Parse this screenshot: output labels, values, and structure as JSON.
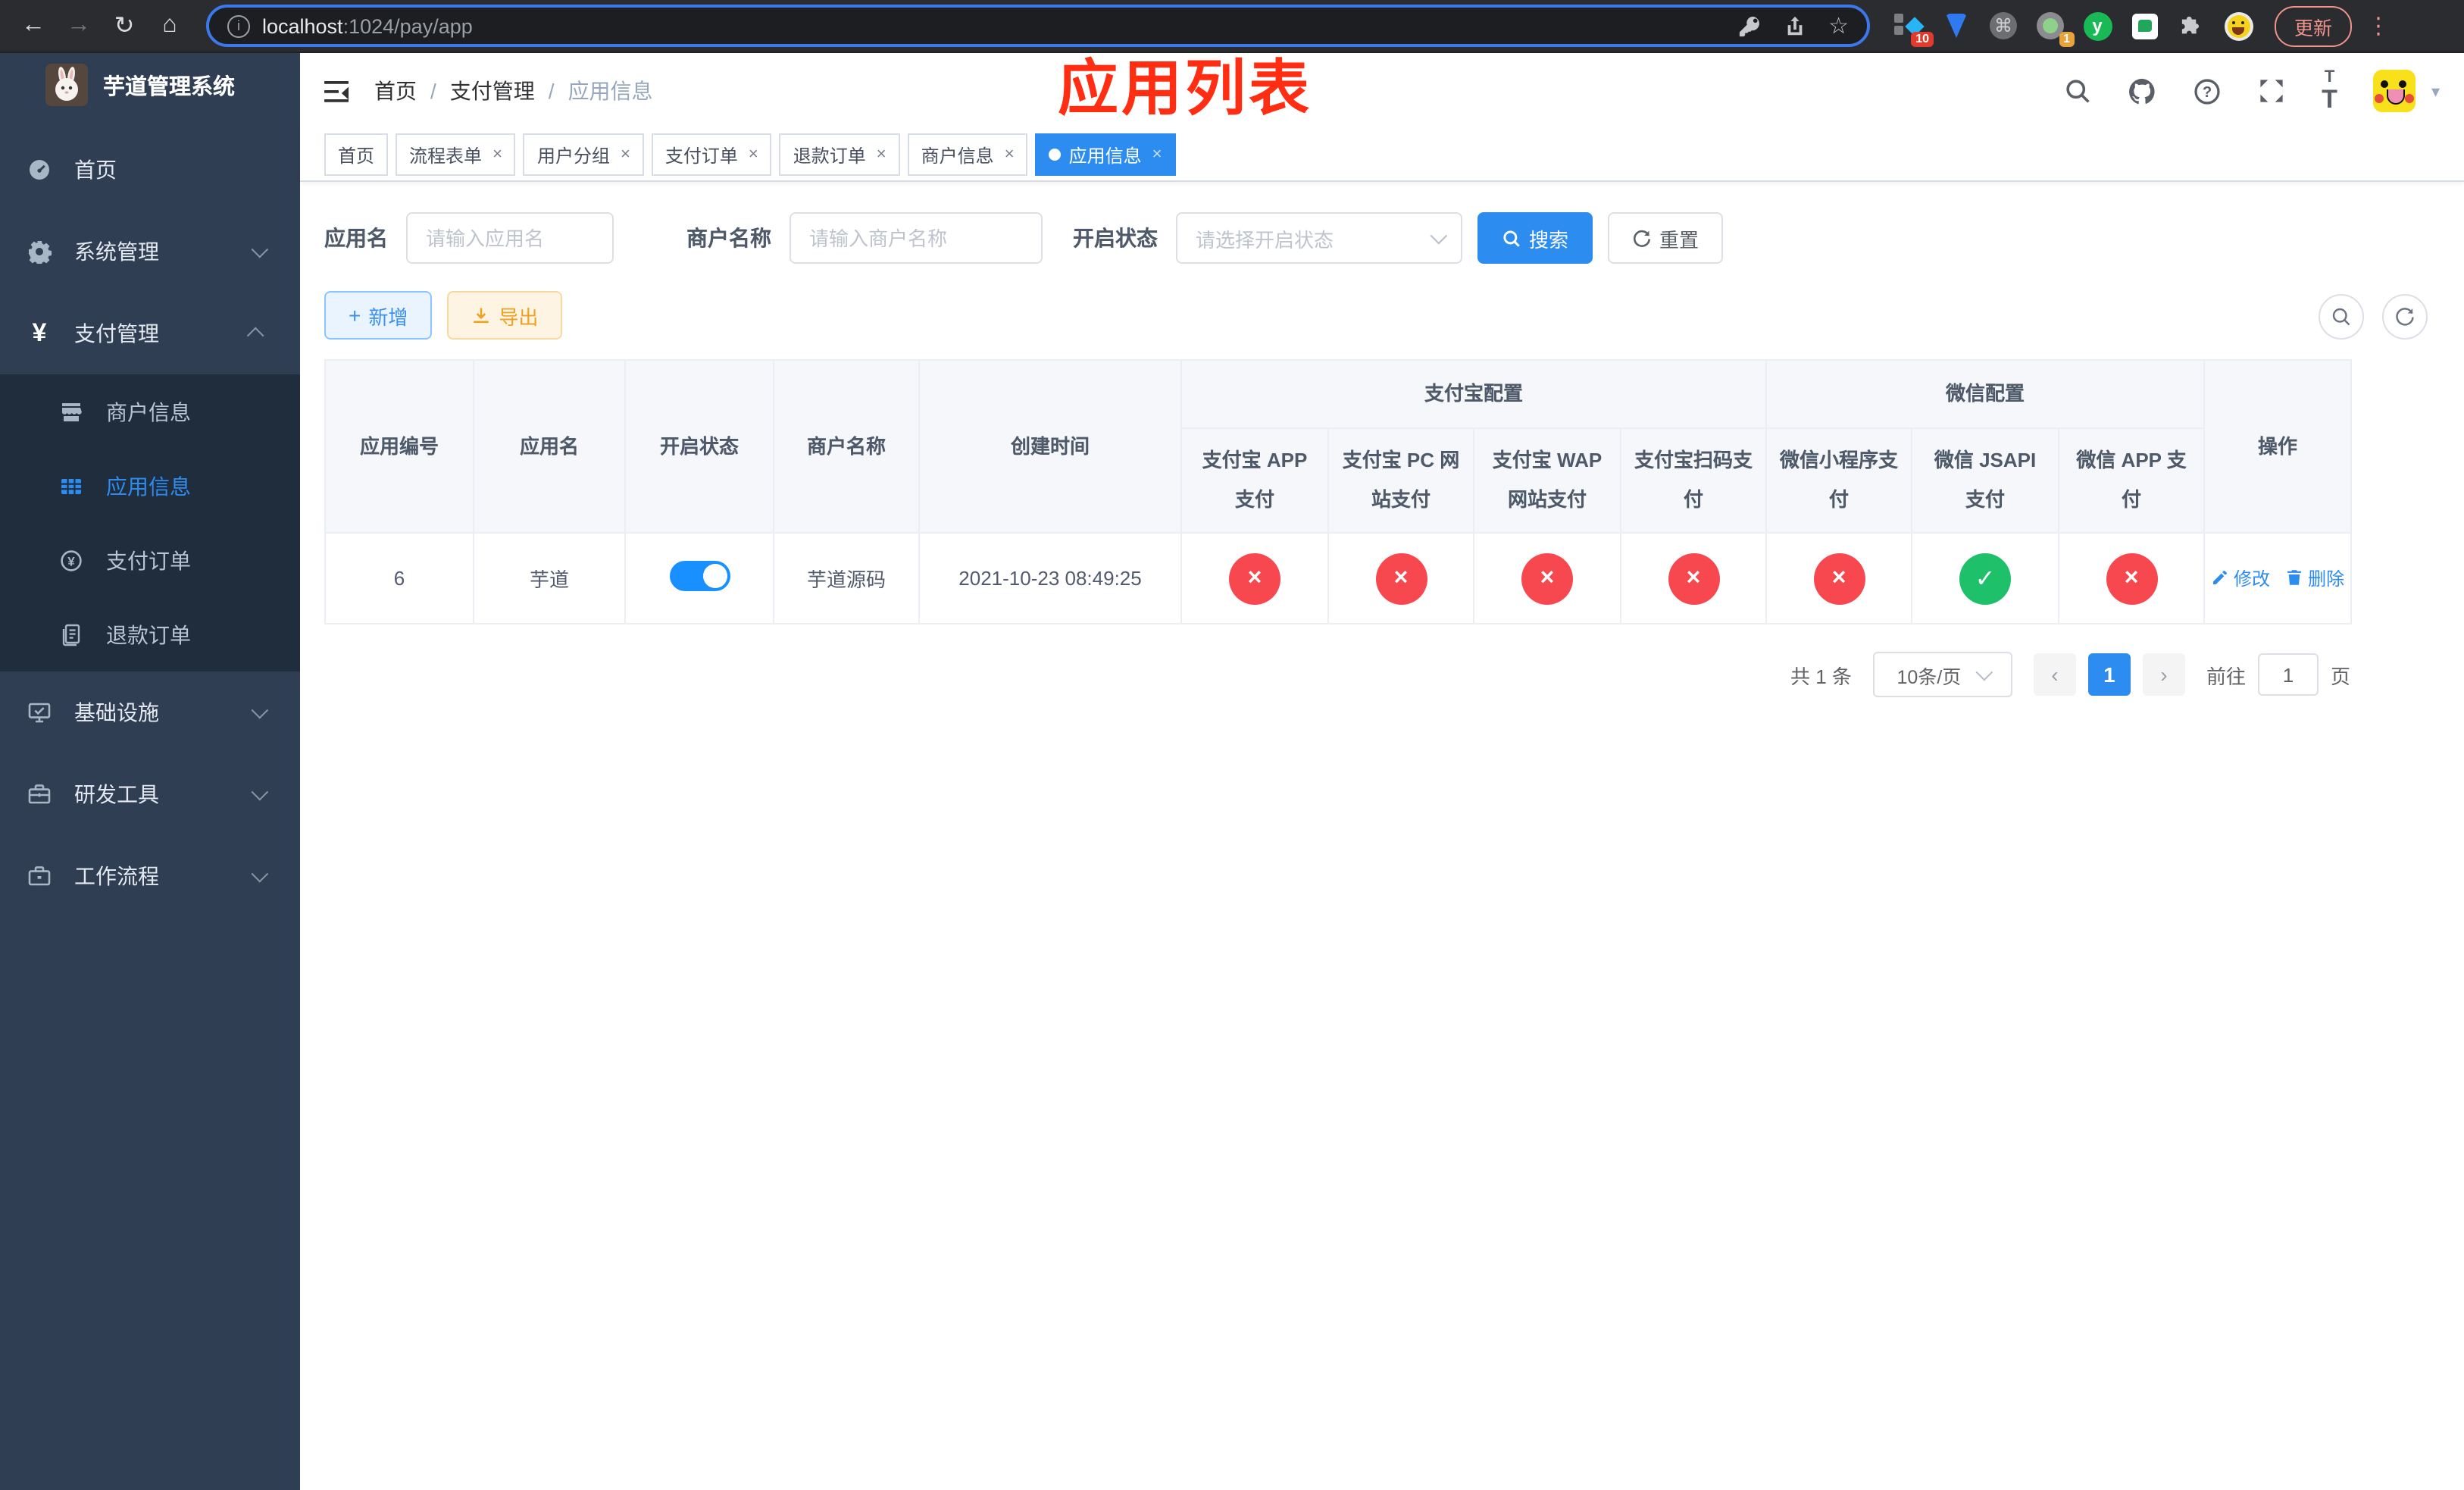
{
  "browser": {
    "url_host": "localhost",
    "url_rest": ":1024/pay/app",
    "update_label": "更新",
    "ext_badge_1": "10",
    "ext_badge_2": "1",
    "ext_y": "y"
  },
  "sidebar": {
    "title": "芋道管理系统",
    "items": [
      {
        "label": "首页",
        "icon": "dashboard-icon",
        "type": "top"
      },
      {
        "label": "系统管理",
        "icon": "gear-icon",
        "type": "top",
        "chevron": "down"
      },
      {
        "label": "支付管理",
        "icon": "yen-icon",
        "type": "top",
        "chevron": "up"
      },
      {
        "label": "商户信息",
        "icon": "shop-icon",
        "type": "sub",
        "active": false
      },
      {
        "label": "应用信息",
        "icon": "grid-icon",
        "type": "sub",
        "active": true
      },
      {
        "label": "支付订单",
        "icon": "coin-icon",
        "type": "sub",
        "active": false
      },
      {
        "label": "退款订单",
        "icon": "document-icon",
        "type": "sub",
        "active": false
      },
      {
        "label": "基础设施",
        "icon": "monitor-icon",
        "type": "top",
        "chevron": "down"
      },
      {
        "label": "研发工具",
        "icon": "toolbox-icon",
        "type": "top",
        "chevron": "down"
      },
      {
        "label": "工作流程",
        "icon": "briefcase-icon",
        "type": "top",
        "chevron": "down"
      }
    ]
  },
  "navbar": {
    "breadcrumb": [
      "首页",
      "支付管理",
      "应用信息"
    ],
    "annotation": "应用列表",
    "icons": [
      "search-icon",
      "github-icon",
      "help-icon",
      "fullscreen-icon",
      "font-size-icon"
    ]
  },
  "tabs": [
    {
      "label": "首页",
      "closable": false,
      "active": false
    },
    {
      "label": "流程表单",
      "closable": true,
      "active": false
    },
    {
      "label": "用户分组",
      "closable": true,
      "active": false
    },
    {
      "label": "支付订单",
      "closable": true,
      "active": false
    },
    {
      "label": "退款订单",
      "closable": true,
      "active": false
    },
    {
      "label": "商户信息",
      "closable": true,
      "active": false
    },
    {
      "label": "应用信息",
      "closable": true,
      "active": true
    }
  ],
  "filters": {
    "app_name_label": "应用名",
    "app_name_placeholder": "请输入应用名",
    "merchant_label": "商户名称",
    "merchant_placeholder": "请输入商户名称",
    "status_label": "开启状态",
    "status_placeholder": "请选择开启状态",
    "search_label": "搜索",
    "reset_label": "重置"
  },
  "toolbar": {
    "add_label": "新增",
    "export_label": "导出"
  },
  "table": {
    "columns": [
      "应用编号",
      "应用名",
      "开启状态",
      "商户名称",
      "创建时间"
    ],
    "groups": [
      {
        "label": "支付宝配置",
        "children": [
          "支付宝 APP 支付",
          "支付宝 PC 网站支付",
          "支付宝 WAP 网站支付",
          "支付宝扫码支付"
        ]
      },
      {
        "label": "微信配置",
        "children": [
          "微信小程序支付",
          "微信 JSAPI 支付",
          "微信 APP 支付"
        ]
      }
    ],
    "action_column": "操作",
    "row": {
      "app_id": "6",
      "app_name": "芋道",
      "enabled": true,
      "merchant": "芋道源码",
      "created_at": "2021-10-23 08:49:25",
      "channel_enabled": [
        false,
        false,
        false,
        false,
        false,
        true,
        false
      ],
      "edit_label": "修改",
      "delete_label": "删除"
    }
  },
  "pagination": {
    "total": "共 1 条",
    "page_size": "10条/页",
    "current_page": "1",
    "goto_label": "前往",
    "goto_value": "1",
    "page_label": "页"
  },
  "colors": {
    "primary": "#2d8cf0",
    "toggle_on": "#1890ff",
    "danger_circle": "#f8484f",
    "success_circle": "#1ec16a",
    "sidebar_bg": "#2f3e52",
    "submenu_bg": "#1f2d3d",
    "annotation": "#ff2d12",
    "update_pill": "#ef938d"
  }
}
